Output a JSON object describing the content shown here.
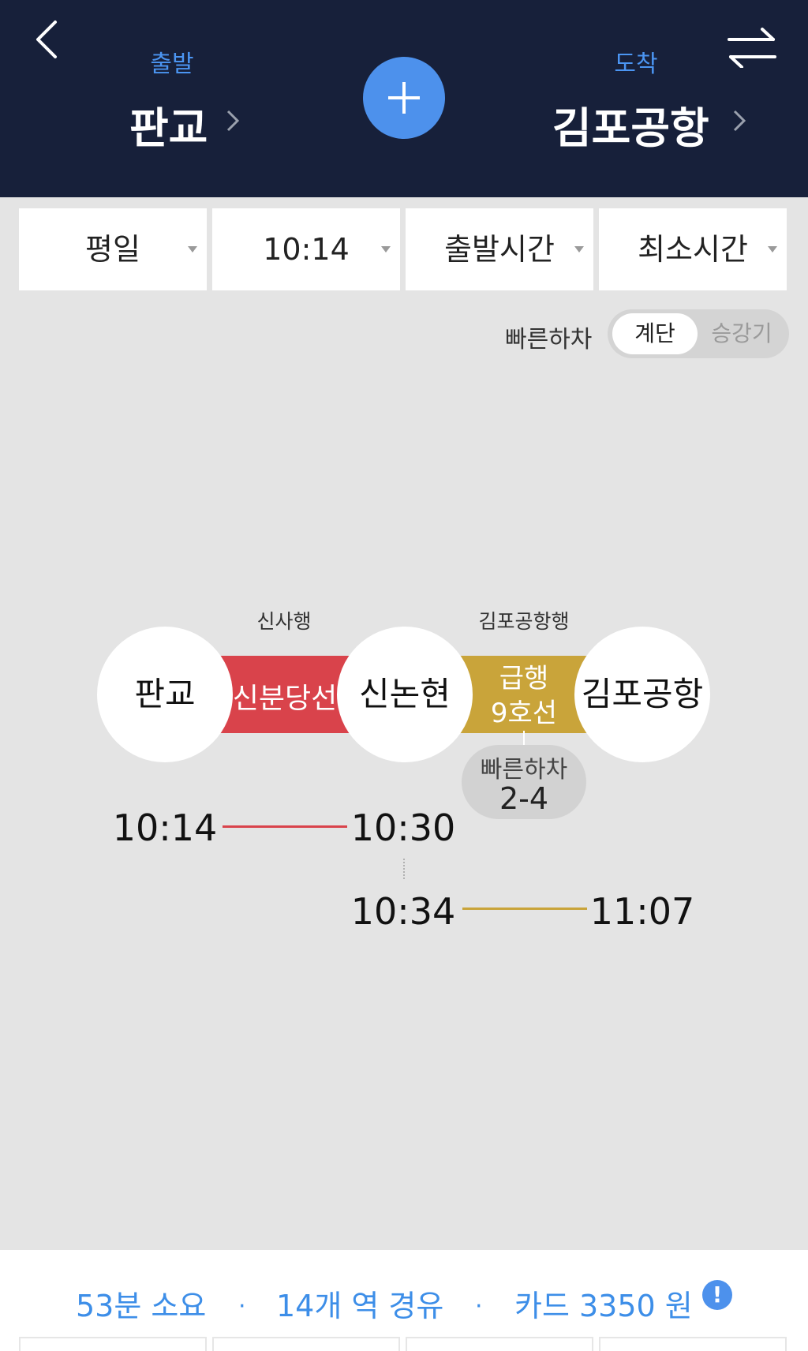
{
  "header": {
    "back_icon": "chevron-left-icon",
    "swap_icon": "swap-arrows-icon",
    "add_icon": "plus-icon",
    "departure": {
      "label": "출발",
      "name": "판교"
    },
    "arrival": {
      "label": "도착",
      "name": "김포공항"
    },
    "colors": {
      "background": "#17203a",
      "accent": "#4b95f2"
    }
  },
  "filters": [
    {
      "label": "평일"
    },
    {
      "label": "10:14"
    },
    {
      "label": "출발시간"
    },
    {
      "label": "최소시간"
    }
  ],
  "fast_alight": {
    "label": "빠른하차",
    "options": [
      "계단",
      "승강기"
    ],
    "selected": "계단"
  },
  "route": {
    "stations": [
      "판교",
      "신논현",
      "김포공항"
    ],
    "segments": [
      {
        "line": "신분당선",
        "direction": "신사행",
        "color": "#d9434b",
        "depart": "10:14",
        "arrive": "10:30"
      },
      {
        "line_type": "급행",
        "line": "9호선",
        "direction": "김포공항행",
        "color": "#c9a43a",
        "depart": "10:34",
        "arrive": "11:07"
      }
    ],
    "fast_alight": {
      "label": "빠른하차",
      "car": "2-4"
    }
  },
  "summary": {
    "duration": "53분 소요",
    "stops": "14개 역 경유",
    "fare": "카드 3350 원",
    "separator": "·",
    "info_icon": "info-icon",
    "info_glyph": "!"
  }
}
